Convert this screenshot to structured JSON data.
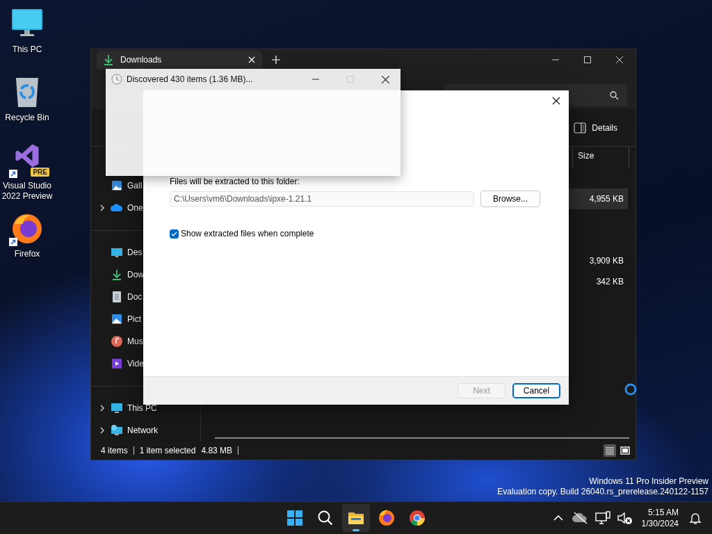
{
  "desktop_icons": [
    {
      "label": "This PC",
      "kind": "monitor",
      "shortcut": false
    },
    {
      "label": "Recycle Bin",
      "kind": "bin",
      "shortcut": false
    },
    {
      "label": "Visual Studio 2022 Preview",
      "kind": "vs",
      "badge": "PRE",
      "shortcut": true
    },
    {
      "label": "Firefox",
      "kind": "firefox",
      "shortcut": true
    }
  ],
  "explorer": {
    "tab": {
      "title": "Downloads"
    },
    "details_button": "Details",
    "sidebar": [
      [
        {
          "label": "Gall",
          "kind": "gallery",
          "expandable": false
        },
        {
          "label": "One",
          "kind": "cloud",
          "expandable": true
        }
      ],
      [
        {
          "label": "Des",
          "kind": "desktop",
          "expandable": false
        },
        {
          "label": "Dow",
          "kind": "download",
          "expandable": false
        },
        {
          "label": "Doc",
          "kind": "document",
          "expandable": false
        },
        {
          "label": "Pict",
          "kind": "picture",
          "expandable": false
        },
        {
          "label": "Mus",
          "kind": "music",
          "expandable": false
        },
        {
          "label": "Vide",
          "kind": "video",
          "expandable": false
        }
      ],
      [
        {
          "label": "This PC",
          "kind": "monitor",
          "expandable": true
        },
        {
          "label": "Network",
          "kind": "network",
          "expandable": true
        }
      ]
    ],
    "size_column": "Size",
    "groups": [
      {
        "rows": [
          {
            "size": "4,955 KB",
            "selected": true
          }
        ]
      },
      {
        "rows": [
          {
            "size": "3,909 KB",
            "selected": false
          },
          {
            "size": "342 KB",
            "selected": false
          }
        ]
      }
    ],
    "status": {
      "count": "4 items",
      "selection": "1 item selected",
      "selection_size": "4.83 MB"
    }
  },
  "extract_dialog": {
    "folder_label": "Files will be extracted to this folder:",
    "folder_path": "C:\\Users\\vm6\\Downloads\\ipxe-1.21.1",
    "browse_button": "Browse...",
    "show_files_label": "Show extracted files when complete",
    "show_files_checked": true,
    "next_button": "Next",
    "next_disabled": true,
    "cancel_button": "Cancel"
  },
  "progress_window": {
    "title": "Discovered 430 items (1.36 MB)...",
    "maximize_disabled": true
  },
  "os_notice": {
    "edition": "Windows 11 Pro Insider Preview",
    "build": "Evaluation copy. Build 26040.rs_prerelease.240122-1157"
  },
  "taskbar": {
    "apps": [
      {
        "kind": "start",
        "active": false
      },
      {
        "kind": "search",
        "active": false
      },
      {
        "kind": "explorer",
        "active": true
      },
      {
        "kind": "firefox",
        "active": false
      },
      {
        "kind": "chrome",
        "active": false
      }
    ],
    "clock": {
      "time": "5:15 AM",
      "date": "1/30/2024"
    }
  }
}
